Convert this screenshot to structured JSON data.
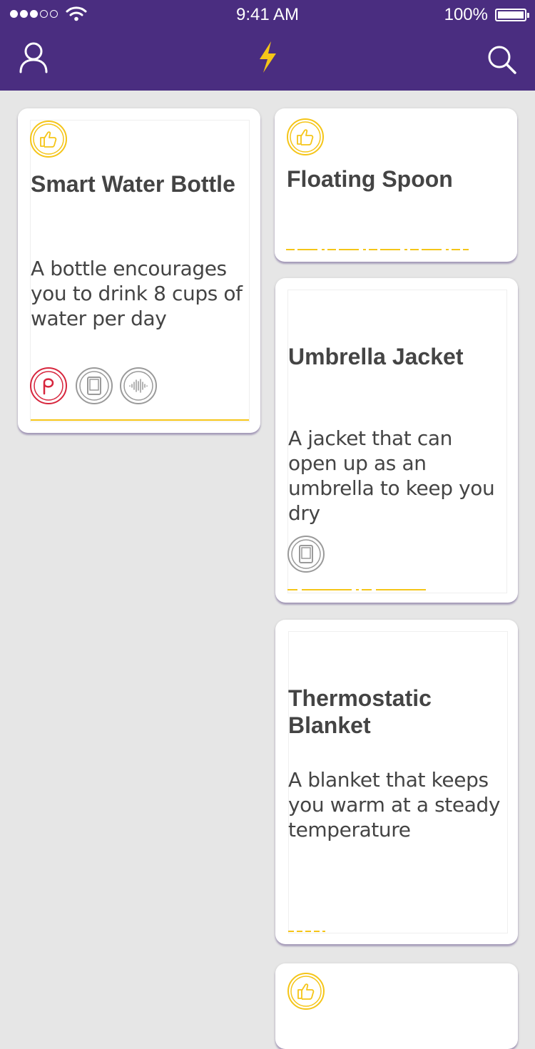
{
  "status_bar": {
    "time": "9:41 AM",
    "battery": "100%",
    "signal_bars_filled": 3,
    "signal_bars_total": 5
  },
  "nav": {
    "profile_icon": "user-icon",
    "center_icon": "lightning-bolt-icon",
    "search_icon": "search-icon"
  },
  "colors": {
    "header": "#4a2d80",
    "accent": "#f5c518",
    "brand_p": "#d7263d",
    "icon_gray": "#9a9a9a",
    "text": "#444444",
    "background": "#e6e6e6"
  },
  "cards": [
    {
      "title": "Smart Water Bottle",
      "description": "A bottle encourages you to drink 8 cups of water per day",
      "liked": true,
      "features": [
        "p-brand-icon",
        "tablet-icon",
        "sound-wave-icon"
      ]
    },
    {
      "title": "Floating Spoon",
      "description": "",
      "liked": true,
      "features": []
    },
    {
      "title": "Umbrella Jacket",
      "description": "A jacket that can open up as an umbrella to keep you dry",
      "liked": false,
      "features": [
        "tablet-icon"
      ]
    },
    {
      "title": "Thermostatic\nBlanket",
      "description": "A blanket that keeps you warm at a steady temperature",
      "liked": false,
      "features": []
    },
    {
      "title": "",
      "description": "",
      "liked": true,
      "features": []
    }
  ]
}
